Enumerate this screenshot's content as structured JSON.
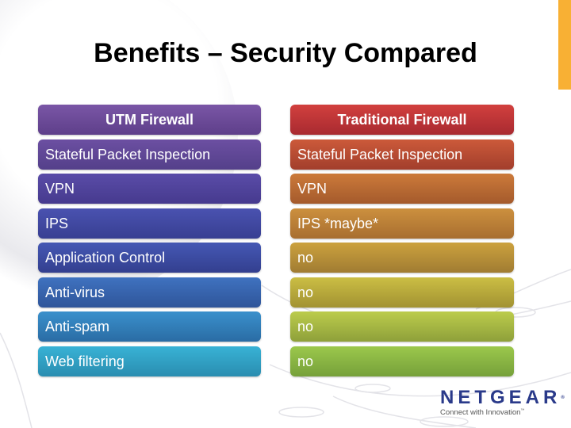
{
  "slide": {
    "title": "Benefits – Security Compared",
    "accent_color": "#f8b034"
  },
  "comparison": {
    "left": {
      "header": "UTM Firewall",
      "rows": [
        "Stateful Packet Inspection",
        "VPN",
        "IPS",
        "Application Control",
        "Anti-virus",
        "Anti-spam",
        "Web filtering"
      ],
      "colors": [
        [
          "#7a56a6",
          "#5e3f8a"
        ],
        [
          "#6c4fa2",
          "#54408a"
        ],
        [
          "#5a4ca8",
          "#463a8e"
        ],
        [
          "#4a52b0",
          "#383f92"
        ],
        [
          "#4558b4",
          "#333f8f"
        ],
        [
          "#3f72c0",
          "#2f559a"
        ],
        [
          "#3a90cc",
          "#2a6ca4"
        ],
        [
          "#38b2d6",
          "#2a8db0"
        ]
      ]
    },
    "right": {
      "header": "Traditional Firewall",
      "rows": [
        "Stateful Packet Inspection",
        "VPN",
        "IPS *maybe*",
        "no",
        "no",
        "no",
        "no"
      ],
      "colors": [
        [
          "#d2403e",
          "#a82a30"
        ],
        [
          "#cc5a3a",
          "#a23e2c"
        ],
        [
          "#cc7a3a",
          "#a45a2c"
        ],
        [
          "#cc903e",
          "#a86e30"
        ],
        [
          "#cca23e",
          "#a07c32"
        ],
        [
          "#cbbe44",
          "#a29232"
        ],
        [
          "#bccc4c",
          "#8ea03a"
        ],
        [
          "#9cc84c",
          "#76a03a"
        ]
      ]
    }
  },
  "logo": {
    "brand": "NETGEAR",
    "registered": "®",
    "tagline": "Connect with Innovation",
    "trademark": "™",
    "brand_color": "#2a3a8a"
  }
}
